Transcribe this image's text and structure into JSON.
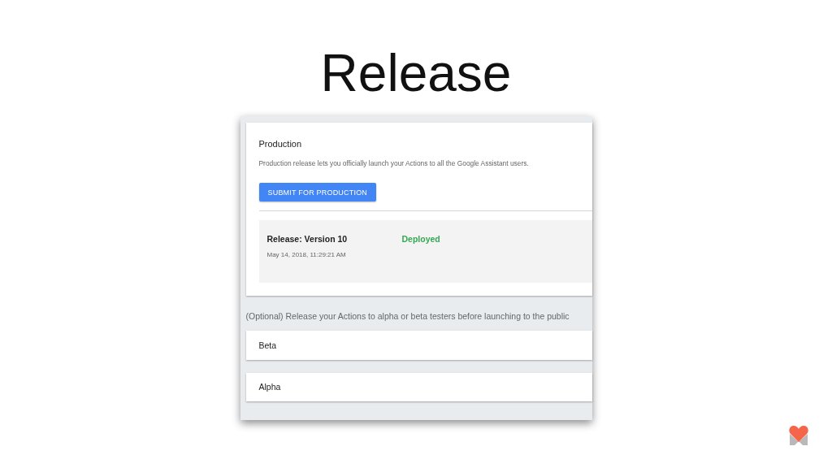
{
  "slide_title": "Release",
  "production": {
    "title": "Production",
    "description": "Production release lets you officially launch your Actions to all the Google Assistant users.",
    "button": "SUBMIT FOR PRODUCTION",
    "release": {
      "name": "Release: Version 10",
      "status": "Deployed",
      "date": "May 14, 2018, 11:29:21 AM"
    }
  },
  "optional_note": "(Optional) Release your Actions to alpha or beta testers before launching to the public",
  "tracks": [
    {
      "title": "Beta"
    },
    {
      "title": "Alpha"
    }
  ]
}
